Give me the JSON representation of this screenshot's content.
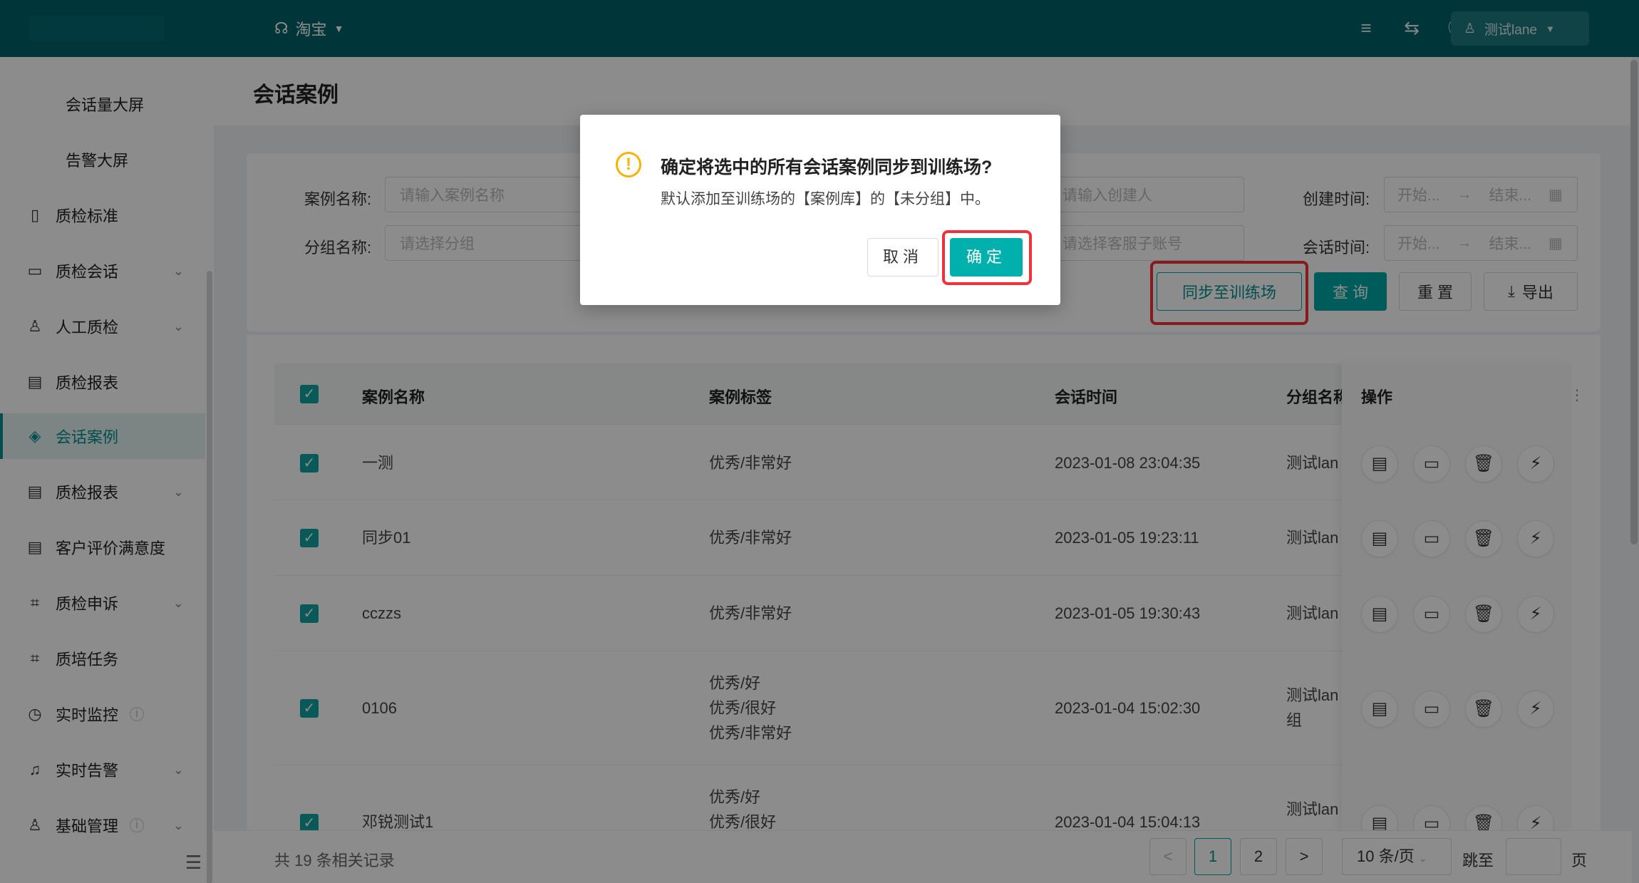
{
  "header": {
    "shop": "淘宝",
    "user": "测试lane"
  },
  "sidebar": {
    "items": [
      {
        "label": "会话量大屏",
        "icon": "none"
      },
      {
        "label": "告警大屏",
        "icon": "none"
      },
      {
        "label": "质检标准",
        "icon": "file-icon"
      },
      {
        "label": "质检会话",
        "icon": "chat-icon"
      },
      {
        "label": "人工质检",
        "icon": "person-icon"
      },
      {
        "label": "质检报表",
        "icon": "report-icon"
      },
      {
        "label": "会话案例",
        "icon": "layers-icon"
      },
      {
        "label": "质检报表",
        "icon": "report-icon"
      },
      {
        "label": "客户评价满意度",
        "icon": "report-icon"
      },
      {
        "label": "质检申诉",
        "icon": "appeal-icon"
      },
      {
        "label": "质培任务",
        "icon": "task-icon"
      },
      {
        "label": "实时监控",
        "icon": "clock-icon"
      },
      {
        "label": "实时告警",
        "icon": "bell-icon"
      },
      {
        "label": "基础管理",
        "icon": "person-icon"
      }
    ]
  },
  "page": {
    "title": "会话案例"
  },
  "filters": {
    "case_name_label": "案例名称:",
    "case_name_placeholder": "请输入案例名称",
    "group_label": "分组名称:",
    "group_placeholder": "请选择分组",
    "creator_placeholder": "请输入创建人",
    "agent_placeholder": "请选择客服子账号",
    "created_label": "创建时间:",
    "session_label": "会话时间:",
    "start": "开始...",
    "end": "结束...",
    "arrow": "→"
  },
  "actions": {
    "sync": "同步至训练场",
    "query": "查 询",
    "reset": "重 置",
    "export": "导出"
  },
  "table": {
    "headers": {
      "name": "案例名称",
      "tags": "案例标签",
      "time": "会话时间",
      "group": "分组名称",
      "ops": "操作"
    },
    "rows": [
      {
        "name": "一测",
        "tags": [
          "优秀/非常好"
        ],
        "time": "2023-01-08 23:04:35",
        "group": "测试lan"
      },
      {
        "name": "同步01",
        "tags": [
          "优秀/非常好"
        ],
        "time": "2023-01-05 19:23:11",
        "group": "测试lan"
      },
      {
        "name": "cczzs",
        "tags": [
          "优秀/非常好"
        ],
        "time": "2023-01-05 19:30:43",
        "group": "测试lan"
      },
      {
        "name": "0106",
        "tags": [
          "优秀/好",
          "优秀/很好",
          "优秀/非常好"
        ],
        "time": "2023-01-04 15:02:30",
        "group": "测试lan",
        "group2": "组"
      },
      {
        "name": "邓锐测试1",
        "tags": [
          "优秀/好",
          "优秀/很好"
        ],
        "time": "2023-01-04 15:04:13",
        "group": "测试lan"
      }
    ]
  },
  "pagination": {
    "total": "共 19 条相关记录",
    "prev": "<",
    "next": ">",
    "page1": "1",
    "page2": "2",
    "size": "10 条/页",
    "jump": "跳至",
    "page_suffix": "页"
  },
  "modal": {
    "title": "确定将选中的所有会话案例同步到训练场?",
    "desc": "默认添加至训练场的【案例库】的【未分组】中。",
    "cancel": "取消",
    "ok": "确定"
  },
  "colors": {
    "header": "#00636b",
    "accent": "#00a8a5",
    "highlight": "#f2323a",
    "warning": "#f5b400"
  }
}
